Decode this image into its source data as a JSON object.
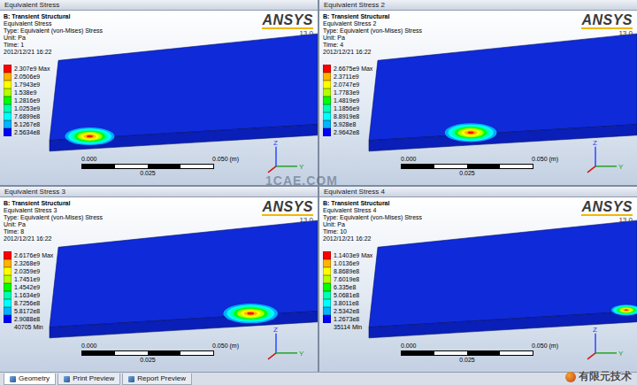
{
  "window": {
    "title": "B: Transient Structural"
  },
  "logo": {
    "name": "ANSYS",
    "version": "13.0"
  },
  "bands": [
    "#ff0000",
    "#ffb400",
    "#ffff00",
    "#b4ff00",
    "#00ff00",
    "#00ffb4",
    "#00ffff",
    "#00b4ff",
    "#0000ff"
  ],
  "panels": [
    {
      "title": "Equivalent Stress",
      "analysis": "B: Transient Structural",
      "result": "Equivalent Stress",
      "type": "Type: Equivalent (von-Mises) Stress",
      "unit": "Unit: Pa",
      "time": "Time: 1",
      "date": "2012/12/21 16:22",
      "legend": [
        "2.307e9 Max",
        "2.0506e9",
        "1.7943e9",
        "1.538e9",
        "1.2816e9",
        "1.0253e9",
        "7.6899e8",
        "5.1267e8",
        "2.5634e8"
      ],
      "hotspot": {
        "position": 0.15,
        "size": 1.0
      }
    },
    {
      "title": "Equivalent Stress 2",
      "analysis": "B: Transient Structural",
      "result": "Equivalent Stress 2",
      "type": "Type: Equivalent (von-Mises) Stress",
      "unit": "Unit: Pa",
      "time": "Time: 4",
      "date": "2012/12/21 16:22",
      "legend": [
        "2.6675e9 Max",
        "2.3711e9",
        "2.0747e9",
        "1.7783e9",
        "1.4819e9",
        "1.1856e9",
        "8.8919e8",
        "5.928e8",
        "2.9642e8"
      ],
      "hotspot": {
        "position": 0.38,
        "size": 1.05
      }
    },
    {
      "title": "Equivalent Stress 3",
      "analysis": "B: Transient Structural",
      "result": "Equivalent Stress 3",
      "type": "Type: Equivalent (von-Mises) Stress",
      "unit": "Unit: Pa",
      "time": "Time: 8",
      "date": "2012/12/21 16:22",
      "legend": [
        "2.6176e9 Max",
        "2.3268e9",
        "2.0359e9",
        "1.7451e9",
        "1.4542e9",
        "1.1634e9",
        "8.7256e8",
        "5.8172e8",
        "2.9088e8",
        "40705 Min"
      ],
      "hotspot": {
        "position": 0.75,
        "size": 1.1
      }
    },
    {
      "title": "Equivalent Stress 4",
      "analysis": "B: Transient Structural",
      "result": "Equivalent Stress 4",
      "type": "Type: Equivalent (von-Mises) Stress",
      "unit": "Unit: Pa",
      "time": "Time: 10",
      "date": "2012/12/21 16:22",
      "legend": [
        "1.1403e9 Max",
        "1.0136e9",
        "8.8689e8",
        "7.6019e8",
        "6.335e8",
        "5.0681e8",
        "3.8011e8",
        "2.5342e8",
        "1.2673e8",
        "35114 Min"
      ],
      "hotspot": {
        "position": 0.96,
        "size": 0.6
      }
    }
  ],
  "scale": {
    "start": "0.000",
    "end": "0.050 (m)",
    "mid": "0.025"
  },
  "axes": [
    "Z",
    "Y"
  ],
  "tabs": [
    {
      "label": "Geometry",
      "selected": true
    },
    {
      "label": "Print Preview",
      "selected": false
    },
    {
      "label": "Report Preview",
      "selected": false
    }
  ],
  "watermarks": {
    "center": "1CAE.COM",
    "corner": "有限元技术"
  }
}
